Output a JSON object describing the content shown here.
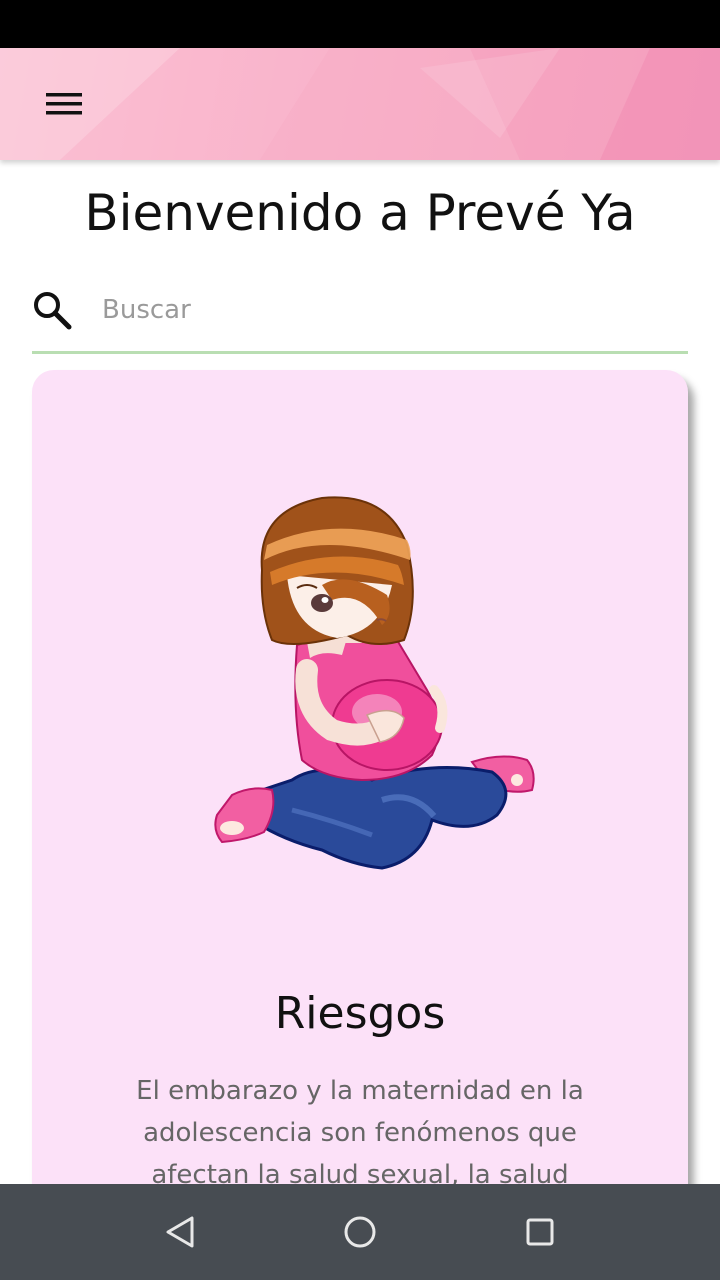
{
  "app": {
    "title": "Bienvenido a Prevé Ya",
    "accent_color": "#f7a6c2",
    "menu_icon": "hamburger-menu-icon"
  },
  "search": {
    "placeholder": "Buscar",
    "value": "",
    "icon": "search-icon",
    "underline_color": "#b9deb2"
  },
  "card": {
    "background": "#fce1f8",
    "image": "pregnant-teen-illustration",
    "title": "Riesgos",
    "text": "El embarazo y la maternidad en la adolescencia son fenómenos que afectan la salud sexual, la salud"
  },
  "nav_bar": {
    "back_icon": "back-triangle-icon",
    "home_icon": "home-circle-icon",
    "recents_icon": "recents-square-icon"
  }
}
